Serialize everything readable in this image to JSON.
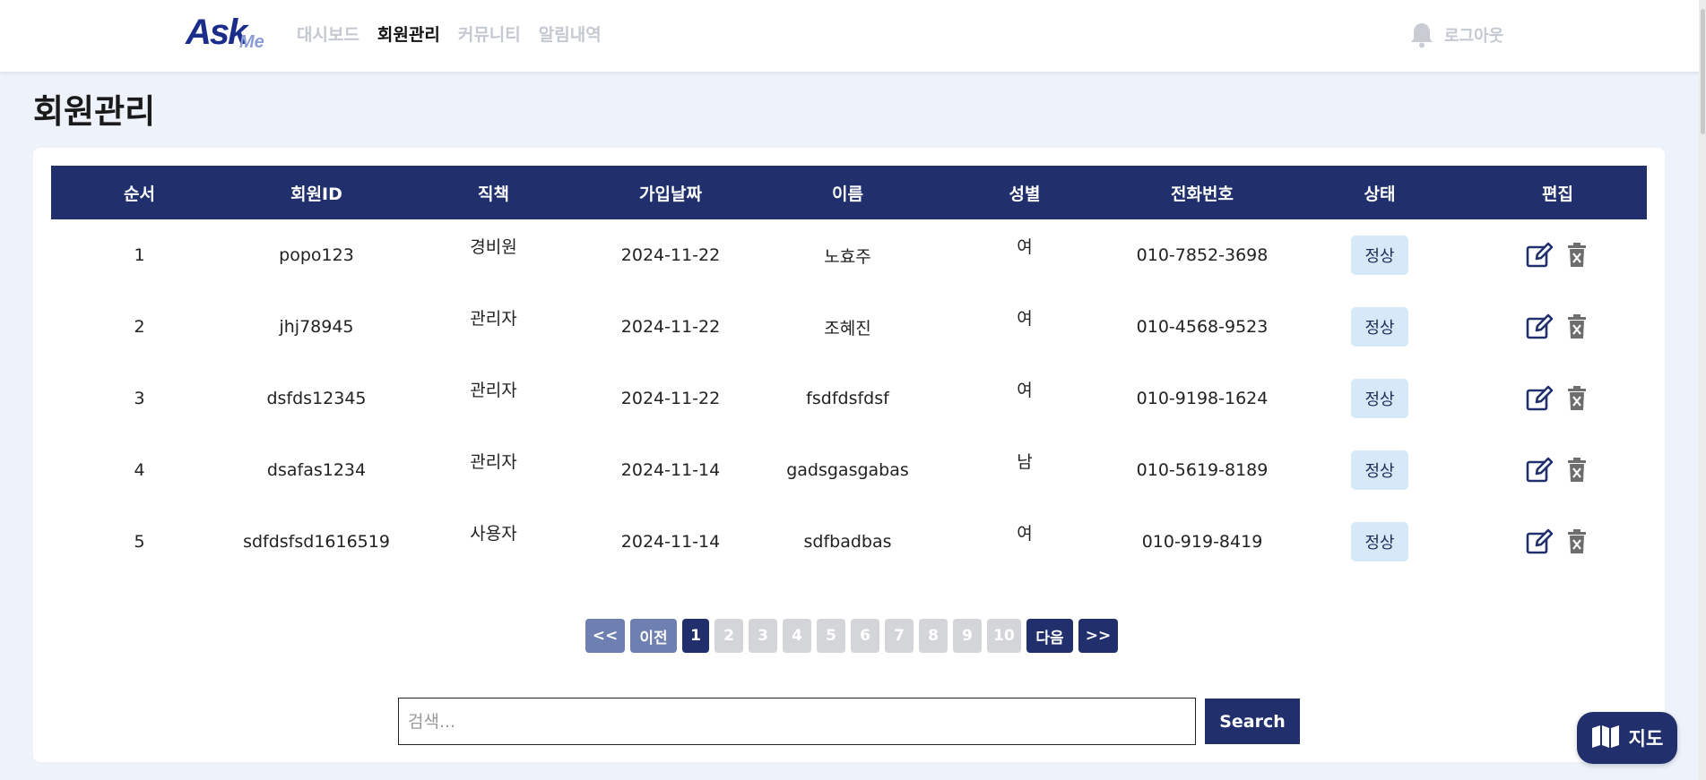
{
  "header": {
    "logo_main": "Ask",
    "logo_sub": "Me",
    "nav": [
      {
        "label": "대시보드"
      },
      {
        "label": "회원관리"
      },
      {
        "label": "커뮤니티"
      },
      {
        "label": "알림내역"
      }
    ],
    "logout_label": "로그아웃",
    "bell_icon": "bell-icon"
  },
  "page_title": "회원관리",
  "table": {
    "headers": [
      "순서",
      "회원ID",
      "직책",
      "가입날짜",
      "이름",
      "성별",
      "전화번호",
      "상태",
      "편집"
    ],
    "rows": [
      {
        "no": "1",
        "id": "popo123",
        "role": "경비원",
        "date": "2024-11-22",
        "name": "노효주",
        "gender": "여",
        "phone": "010-7852-3698",
        "status": "정상"
      },
      {
        "no": "2",
        "id": "jhj78945",
        "role": "관리자",
        "date": "2024-11-22",
        "name": "조혜진",
        "gender": "여",
        "phone": "010-4568-9523",
        "status": "정상"
      },
      {
        "no": "3",
        "id": "dsfds12345",
        "role": "관리자",
        "date": "2024-11-22",
        "name": "fsdfdsfdsf",
        "gender": "여",
        "phone": "010-9198-1624",
        "status": "정상"
      },
      {
        "no": "4",
        "id": "dsafas1234",
        "role": "관리자",
        "date": "2024-11-14",
        "name": "gadsgasgabas",
        "gender": "남",
        "phone": "010-5619-8189",
        "status": "정상"
      },
      {
        "no": "5",
        "id": "sdfdsfsd1616519",
        "role": "사용자",
        "date": "2024-11-14",
        "name": "sdfbadbas",
        "gender": "여",
        "phone": "010-919-8419",
        "status": "정상"
      }
    ],
    "edit_icon": "edit-icon",
    "delete_icon": "trash-icon"
  },
  "pagination": {
    "first": "<<",
    "prev": "이전",
    "pages": [
      "1",
      "2",
      "3",
      "4",
      "5",
      "6",
      "7",
      "8",
      "9",
      "10"
    ],
    "current": "1",
    "next": "다음",
    "last": ">>"
  },
  "search": {
    "placeholder": "검색...",
    "value": "",
    "button": "Search"
  },
  "map_button": {
    "label": "지도",
    "icon": "map-icon"
  },
  "colors": {
    "primary": "#21306d",
    "background": "#eef3fb",
    "badge_bg": "#d6e9f7",
    "muted_nav": "#c4c8d0"
  }
}
